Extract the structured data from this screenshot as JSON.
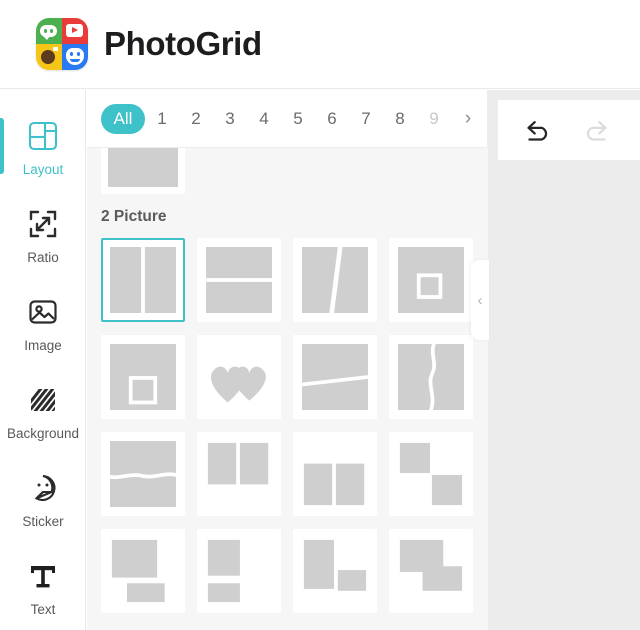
{
  "header": {
    "brand_name": "PhotoGrid",
    "logo": {
      "cells": [
        "speech-bubble-green",
        "play-red",
        "camera-yellow",
        "smiley-blue"
      ]
    }
  },
  "colors": {
    "accent": "#3FC1C9",
    "panel_bg": "#f6f6f6",
    "right_bg": "#ececec",
    "cell": "#cfcfcf",
    "text": "#595959"
  },
  "sidebar": {
    "items": [
      {
        "label": "Layout",
        "icon": "layout-icon",
        "active": true
      },
      {
        "label": "Ratio",
        "icon": "ratio-icon",
        "active": false
      },
      {
        "label": "Image",
        "icon": "image-icon",
        "active": false
      },
      {
        "label": "Background",
        "icon": "background-icon",
        "active": false
      },
      {
        "label": "Sticker",
        "icon": "sticker-icon",
        "active": false
      },
      {
        "label": "Text",
        "icon": "text-icon",
        "active": false
      }
    ]
  },
  "tabbar": {
    "tabs": [
      {
        "label": "All",
        "selected": true,
        "faded": false
      },
      {
        "label": "1",
        "selected": false,
        "faded": false
      },
      {
        "label": "2",
        "selected": false,
        "faded": false
      },
      {
        "label": "3",
        "selected": false,
        "faded": false
      },
      {
        "label": "4",
        "selected": false,
        "faded": false
      },
      {
        "label": "5",
        "selected": false,
        "faded": false
      },
      {
        "label": "6",
        "selected": false,
        "faded": false
      },
      {
        "label": "7",
        "selected": false,
        "faded": false
      },
      {
        "label": "8",
        "selected": false,
        "faded": false
      },
      {
        "label": "9",
        "selected": false,
        "faded": true
      }
    ],
    "next_arrow": "›"
  },
  "layouts": {
    "section_title": "2 Picture",
    "row1": [
      {
        "name": "two-column-vertical-split",
        "selected": true
      },
      {
        "name": "two-row-horizontal-split",
        "selected": false
      },
      {
        "name": "diagonal-vertical-split",
        "selected": false
      },
      {
        "name": "picture-in-picture-center",
        "selected": false
      }
    ],
    "row2": [
      {
        "name": "picture-in-picture-lower-left",
        "selected": false
      },
      {
        "name": "double-heart-shape",
        "selected": false
      },
      {
        "name": "slanted-horizontal-split",
        "selected": false
      },
      {
        "name": "torn-vertical-split",
        "selected": false
      }
    ],
    "row3": [
      {
        "name": "torn-horizontal-split",
        "selected": false
      },
      {
        "name": "two-panels-top-aligned",
        "selected": false
      },
      {
        "name": "two-panels-bottom-aligned",
        "selected": false
      },
      {
        "name": "staggered-diagonal-pair",
        "selected": false
      }
    ],
    "row4": [
      {
        "name": "wide-top-small-bottom",
        "selected": false
      },
      {
        "name": "square-top-bar-bottom",
        "selected": false
      },
      {
        "name": "tall-left-small-right",
        "selected": false
      },
      {
        "name": "overlap-step-pair",
        "selected": false
      }
    ]
  },
  "right_panel": {
    "undo_label": "undo-icon",
    "redo_label": "redo-icon",
    "redo_disabled": true,
    "collapse_arrow": "‹"
  }
}
